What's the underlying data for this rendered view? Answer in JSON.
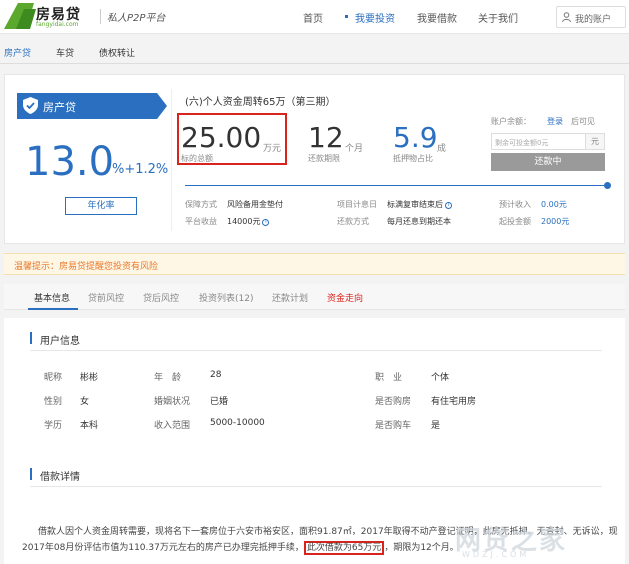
{
  "header": {
    "logo_text": "房易贷",
    "logo_url": "fangyidai.com",
    "slogan": "私人P2P平台",
    "nav": [
      "首页",
      "我要投资",
      "我要借款",
      "关于我们"
    ],
    "account_label": "我的账户"
  },
  "subnav": [
    "房产贷",
    "车贷",
    "债权转让"
  ],
  "product": {
    "badge": "房产贷",
    "rate": "13.0",
    "rate_suffix": "%+1.2%",
    "rate_button": "年化率",
    "title": "(六)个人资金周转65万（第三期）",
    "amount": "25.00",
    "amount_unit": "万元",
    "amount_label": "标的总额",
    "term": "12",
    "term_unit": "个月",
    "term_label": "还款期限",
    "ratio": "5.9",
    "ratio_unit": "成",
    "ratio_label": "抵押物占比"
  },
  "account": {
    "balance_label": "账户余额：",
    "login_link": "登录",
    "after_login": "后可见",
    "input_placeholder": "剩余可投金额0元",
    "input_unit": "元",
    "button": "还款中"
  },
  "info": {
    "guarantee_label": "保障方式",
    "guarantee_value": "风险备用金垫付",
    "earning_label": "平台收益",
    "earning_value": "14000元",
    "interest_date_label": "项目计息日",
    "interest_date_value": "标满复审结束后",
    "repay_label": "还款方式",
    "repay_value": "每月还息到期还本",
    "expected_label": "预计收入",
    "expected_value": "0.00元",
    "min_label": "起投金额",
    "min_value": "2000元"
  },
  "notice": "温馨提示：房易贷提醒您投资有风险",
  "tabs": [
    "基本信息",
    "贷前风控",
    "贷后风控",
    "投资列表(12)",
    "还款计划",
    "资金走向"
  ],
  "user_info": {
    "title": "用户信息",
    "rows": [
      [
        "昵称",
        "彬彬",
        "年　龄",
        "28",
        "职　业",
        "个体"
      ],
      [
        "性别",
        "女",
        "婚姻状况",
        "已婚",
        "是否购房",
        "有住宅用房"
      ],
      [
        "学历",
        "本科",
        "收入范围",
        "5000-10000",
        "是否购车",
        "是"
      ]
    ]
  },
  "loan_detail": {
    "title": "借款详情",
    "line1": "借款人因个人资金周转需要，现将名下一套房位于六安市裕安区，面积91.87㎡，2017年取得不动产登记证明，此房无抵押、无查封、无诉讼，现",
    "line2a": "2017年08月份评估市值为110.37万元左右的房产已办理完抵押手续，",
    "line2b": "此次借款为65万元",
    "line2c": "，期限为12个月。"
  },
  "watermark": "网贷之家",
  "watermark_url": "WDZJ.COM",
  "colors": {
    "brand": "#2a6fc0",
    "highlight": "#d9241e",
    "notice": "#e8792a"
  }
}
